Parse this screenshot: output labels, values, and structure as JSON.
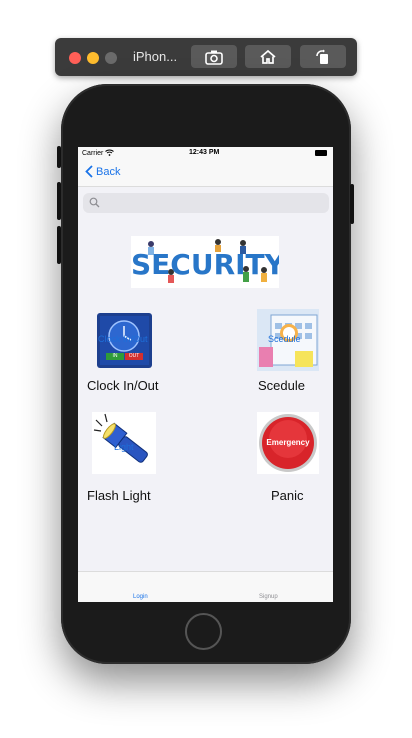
{
  "simulator": {
    "title": "iPhon..."
  },
  "status_bar": {
    "carrier": "Carrier",
    "time": "12:43 PM"
  },
  "nav": {
    "back_label": "Back"
  },
  "search": {
    "placeholder": ""
  },
  "banner": {
    "text": "SECURITY"
  },
  "tiles": [
    {
      "label": "Clock In/Out",
      "overlay": "Clock In/Out",
      "in_text": "IN",
      "out_text": "OUT"
    },
    {
      "label": "Scedule",
      "overlay": "Scedule"
    },
    {
      "label": "Flash Light",
      "overlay": "Light"
    },
    {
      "label": "Panic",
      "emergency_text": "Emergency"
    }
  ],
  "tabbar": {
    "tabs": [
      {
        "label": "Login",
        "active": true
      },
      {
        "label": "Signup",
        "active": false
      }
    ]
  },
  "colors": {
    "accent": "#1a73e8",
    "banner_blue": "#2876c8",
    "panic_red": "#d8242a"
  }
}
